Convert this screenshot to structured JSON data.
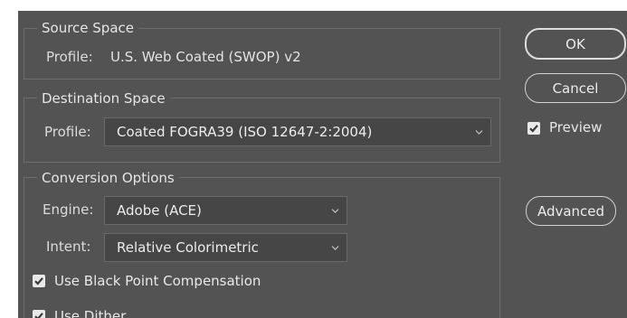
{
  "source_space": {
    "title": "Source Space",
    "profile_label": "Profile:",
    "profile_value": "U.S. Web Coated (SWOP) v2"
  },
  "destination_space": {
    "title": "Destination Space",
    "profile_label": "Profile:",
    "profile_selected": "Coated FOGRA39 (ISO 12647-2:2004)"
  },
  "conversion_options": {
    "title": "Conversion Options",
    "engine_label": "Engine:",
    "engine_selected": "Adobe (ACE)",
    "intent_label": "Intent:",
    "intent_selected": "Relative Colorimetric",
    "black_point": {
      "label": "Use Black Point Compensation",
      "checked": true
    },
    "dither": {
      "label": "Use Dither",
      "checked": true
    }
  },
  "buttons": {
    "ok": "OK",
    "cancel": "Cancel",
    "advanced": "Advanced"
  },
  "preview": {
    "label": "Preview",
    "checked": true
  },
  "colors": {
    "panel_bg": "#535353",
    "field_bg": "#464646",
    "text": "#e4e4e4",
    "border": "#6c6c6c"
  },
  "icons": {
    "dropdown": "chevron-down-icon",
    "check": "checkmark-icon"
  }
}
